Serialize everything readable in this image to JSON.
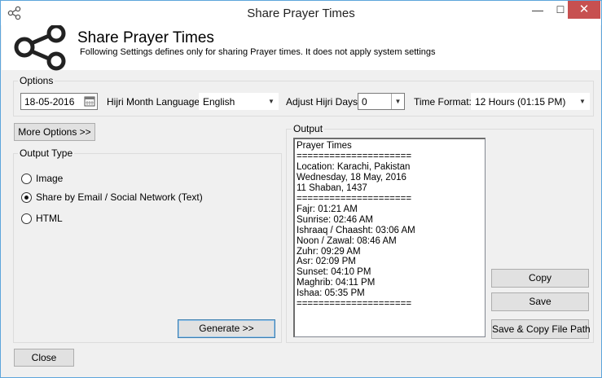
{
  "window": {
    "title": "Share Prayer Times",
    "minimize_glyph": "—",
    "maximize_glyph": "☐",
    "close_glyph": "✕"
  },
  "header": {
    "title": "Share Prayer Times",
    "subtitle": "Following Settings defines only for sharing Prayer times. It does not apply system settings"
  },
  "options": {
    "legend": "Options",
    "date_value": "18-05-2016",
    "hijri_language_label": "Hijri Month Language:",
    "hijri_language_value": "English",
    "adjust_hijri_label": "Adjust Hijri Days:",
    "adjust_hijri_value": "0",
    "time_format_label": "Time Format:",
    "time_format_value": "12 Hours (01:15 PM)"
  },
  "more_options_button": "More Options >>",
  "output_type": {
    "legend": "Output Type",
    "choices": [
      {
        "label": "Image",
        "checked": false
      },
      {
        "label": "Share by Email / Social Network (Text)",
        "checked": true
      },
      {
        "label": "HTML",
        "checked": false
      }
    ]
  },
  "generate_button": "Generate >>",
  "output": {
    "legend": "Output",
    "lines": [
      "Prayer Times",
      "=====================",
      "Location: Karachi, Pakistan",
      "Wednesday, 18 May, 2016",
      "11 Shaban, 1437",
      "=====================",
      "Fajr: 01:21 AM",
      "Sunrise: 02:46 AM",
      "Ishraaq / Chaasht: 03:06 AM",
      "Noon / Zawal: 08:46 AM",
      "Zuhr: 09:29 AM",
      "Asr: 02:09 PM",
      "Sunset: 04:10 PM",
      "Maghrib: 04:11 PM",
      "Ishaa: 05:35 PM",
      "====================="
    ]
  },
  "copy_button": "Copy",
  "save_button": "Save",
  "save_copy_path_button": "Save & Copy File Path",
  "close_button": "Close",
  "icons": {
    "share": "share-icon",
    "calendar": "calendar-icon",
    "dropdown": "chevron-down-icon"
  }
}
